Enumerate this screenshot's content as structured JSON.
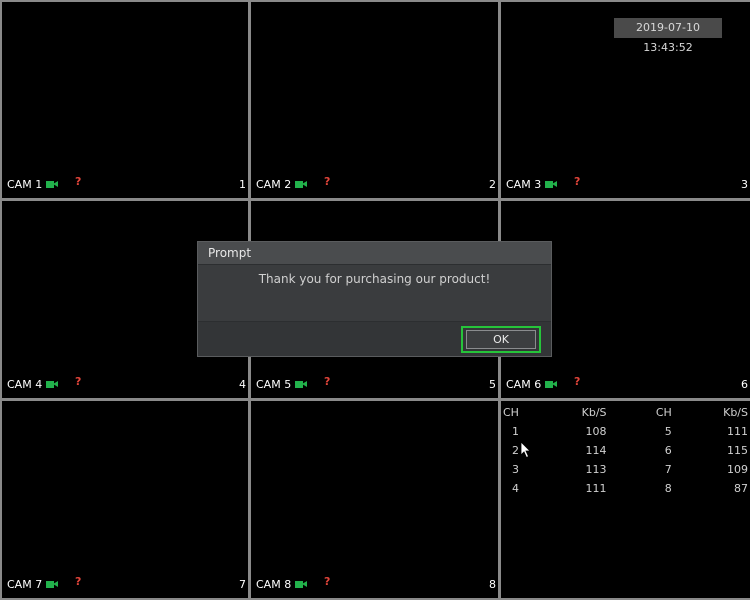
{
  "timestamp": "2019-07-10 13:43:52",
  "cameras": [
    {
      "label": "CAM 1",
      "channel": "1"
    },
    {
      "label": "CAM 2",
      "channel": "2"
    },
    {
      "label": "CAM 3",
      "channel": "3"
    },
    {
      "label": "CAM 4",
      "channel": "4"
    },
    {
      "label": "CAM 5",
      "channel": "5"
    },
    {
      "label": "CAM 6",
      "channel": "6"
    },
    {
      "label": "CAM 7",
      "channel": "7"
    },
    {
      "label": "CAM 8",
      "channel": "8"
    }
  ],
  "status_icon_glyph": "?",
  "colors": {
    "camera_icon": "#22b24c",
    "status_icon": "#e0443a",
    "ok_highlight": "#26c43a"
  },
  "bitrate": {
    "headers": [
      "CH",
      "Kb/S",
      "CH",
      "Kb/S"
    ],
    "rows": [
      [
        "1",
        "108",
        "5",
        "111"
      ],
      [
        "2",
        "114",
        "6",
        "115"
      ],
      [
        "3",
        "113",
        "7",
        "109"
      ],
      [
        "4",
        "111",
        "8",
        "87"
      ]
    ]
  },
  "dialog": {
    "title": "Prompt",
    "message": "Thank you for purchasing our product!",
    "ok_label": "OK"
  }
}
